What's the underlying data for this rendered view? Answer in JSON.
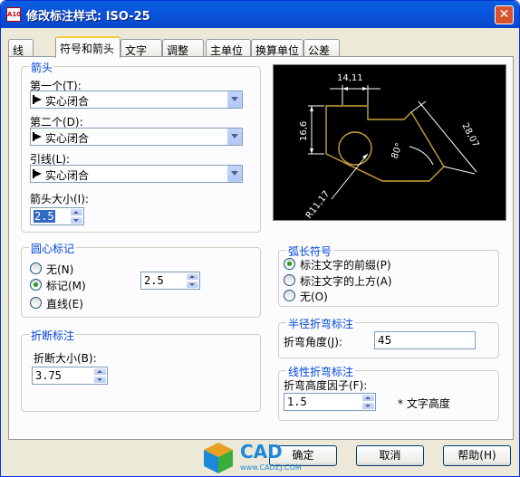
{
  "window": {
    "title": "修改标注样式: ISO-25",
    "app_icon_text": "A10",
    "close_symbol": "✕"
  },
  "tabs": [
    "线",
    "符号和箭头",
    "文字",
    "调整",
    "主单位",
    "换算单位",
    "公差"
  ],
  "active_tab": "符号和箭头",
  "arrows": {
    "group_label": "箭头",
    "first_label": "第一个(T):",
    "first_value": "实心闭合",
    "second_label": "第二个(D):",
    "second_value": "实心闭合",
    "leader_label": "引线(L):",
    "leader_value": "实心闭合",
    "size_label": "箭头大小(I):",
    "size_value": "2.5"
  },
  "center_marks": {
    "group_label": "圆心标记",
    "options": [
      "无(N)",
      "标记(M)",
      "直线(E)"
    ],
    "selected": "标记(M)",
    "size_value": "2.5"
  },
  "break": {
    "group_label": "折断标注",
    "size_label": "折断大小(B):",
    "size_value": "3.75"
  },
  "arc_length": {
    "group_label": "弧长符号",
    "options": [
      "标注文字的前缀(P)",
      "标注文字的上方(A)",
      "无(O)"
    ],
    "selected": "标注文字的前缀(P)"
  },
  "radius_jog": {
    "group_label": "半径折弯标注",
    "angle_label": "折弯角度(J):",
    "angle_value": "45"
  },
  "linear_jog": {
    "group_label": "线性折弯标注",
    "factor_label": "折弯高度因子(F):",
    "factor_value": "1.5",
    "suffix": "* 文字高度"
  },
  "preview": {
    "dims": [
      "14,11",
      "16,6",
      "28,07",
      "80°",
      "R11,17"
    ]
  },
  "buttons": {
    "ok": "确定",
    "cancel": "取消",
    "help": "帮助(H)"
  },
  "watermark": {
    "brand": "CAD",
    "url": "www.CADZJ.COM"
  },
  "colors": {
    "title_bar": "#0855DD",
    "preview_bg": "#000000",
    "geometry": "#C8A23C",
    "dim_line": "#FFFFFF"
  }
}
